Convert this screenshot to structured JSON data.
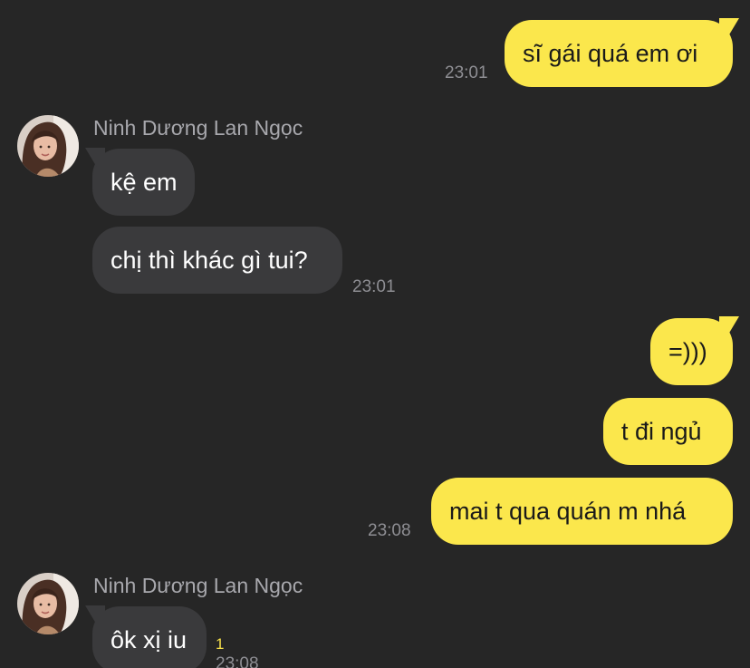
{
  "contact": {
    "name": "Ninh Dương Lan Ngọc"
  },
  "messages": [
    {
      "direction": "outgoing",
      "text": "sĩ gái quá em ơi",
      "time": "23:01"
    },
    {
      "direction": "incoming",
      "text": "kệ em"
    },
    {
      "direction": "incoming",
      "text": "chị thì khác gì tui?",
      "time": "23:01"
    },
    {
      "direction": "outgoing",
      "text": "=)))"
    },
    {
      "direction": "outgoing",
      "text": "t đi ngủ"
    },
    {
      "direction": "outgoing",
      "text": "mai t qua quán m nhá",
      "time": "23:08"
    },
    {
      "direction": "incoming",
      "text": "ôk xị iu",
      "time": "23:08",
      "unread_count": "1"
    }
  ],
  "colors": {
    "background": "#262626",
    "outgoing_bubble": "#fbe74c",
    "incoming_bubble": "#3a3a3c",
    "timestamp": "#8e8e93",
    "unread_marker": "#f7e04a"
  },
  "icons": {
    "avatar": "contact-avatar-photo"
  }
}
